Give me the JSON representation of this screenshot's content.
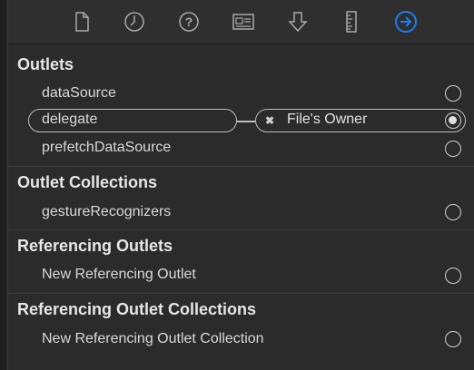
{
  "toolbar": {
    "icons": [
      "file-icon",
      "clock-icon",
      "help-icon",
      "identity-card-icon",
      "attributes-arrow-icon",
      "ruler-icon",
      "connections-arrow-icon"
    ],
    "active_color": "#1e7cf2"
  },
  "sections": {
    "outlets": {
      "title": "Outlets",
      "rows": [
        "dataSource",
        "delegate",
        "prefetchDataSource"
      ],
      "connected_target": "File's Owner"
    },
    "outlet_collections": {
      "title": "Outlet Collections",
      "rows": [
        "gestureRecognizers"
      ]
    },
    "referencing_outlets": {
      "title": "Referencing Outlets",
      "rows": [
        "New Referencing Outlet"
      ]
    },
    "referencing_outlet_collections": {
      "title": "Referencing Outlet Collections",
      "rows": [
        "New Referencing Outlet Collection"
      ]
    }
  },
  "remove_glyph": "✖"
}
